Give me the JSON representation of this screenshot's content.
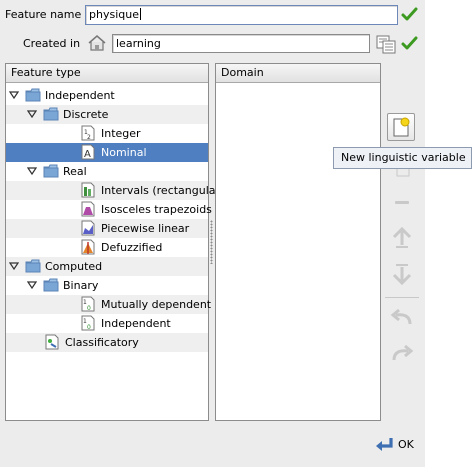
{
  "form": {
    "feature_name_label": "Feature name",
    "feature_name_value": "physique",
    "created_in_label": "Created in",
    "created_in_value": "learning"
  },
  "tree": {
    "header": "Feature type",
    "rows": [
      {
        "label": "Independent",
        "level": 0,
        "type": "folder",
        "expanded": true
      },
      {
        "label": "Discrete",
        "level": 1,
        "type": "folder",
        "expanded": true
      },
      {
        "label": "Integer",
        "level": 2,
        "type": "integer"
      },
      {
        "label": "Nominal",
        "level": 2,
        "type": "nominal",
        "selected": true
      },
      {
        "label": "Real",
        "level": 1,
        "type": "folder",
        "expanded": true
      },
      {
        "label": "Intervals (rectangular)",
        "level": 2,
        "type": "rect"
      },
      {
        "label": "Isosceles trapezoids",
        "level": 2,
        "type": "trap"
      },
      {
        "label": "Piecewise linear",
        "level": 2,
        "type": "piece"
      },
      {
        "label": "Defuzzified",
        "level": 2,
        "type": "defuzz"
      },
      {
        "label": "Computed",
        "level": 0,
        "type": "folder",
        "expanded": true
      },
      {
        "label": "Binary",
        "level": 1,
        "type": "folder",
        "expanded": true
      },
      {
        "label": "Mutually dependent",
        "level": 2,
        "type": "binary"
      },
      {
        "label": "Independent",
        "level": 2,
        "type": "binary"
      },
      {
        "label": "Classificatory",
        "level": 1,
        "type": "class"
      }
    ]
  },
  "domain": {
    "header": "Domain"
  },
  "toolbar": {
    "tooltip": "New linguistic variable",
    "buttons": [
      {
        "name": "new-linguistic-variable-button",
        "enabled": true
      },
      {
        "name": "edit-button",
        "enabled": false
      },
      {
        "name": "remove-button",
        "enabled": false
      },
      {
        "name": "move-top-button",
        "enabled": false
      },
      {
        "name": "move-bottom-button",
        "enabled": false
      },
      {
        "name": "undo-button",
        "enabled": false
      },
      {
        "name": "redo-button",
        "enabled": false
      }
    ]
  },
  "footer": {
    "ok_label": "OK"
  },
  "colors": {
    "selection": "#4f7ec1",
    "check": "#3c9a20",
    "folder": "#7aa6d6"
  }
}
